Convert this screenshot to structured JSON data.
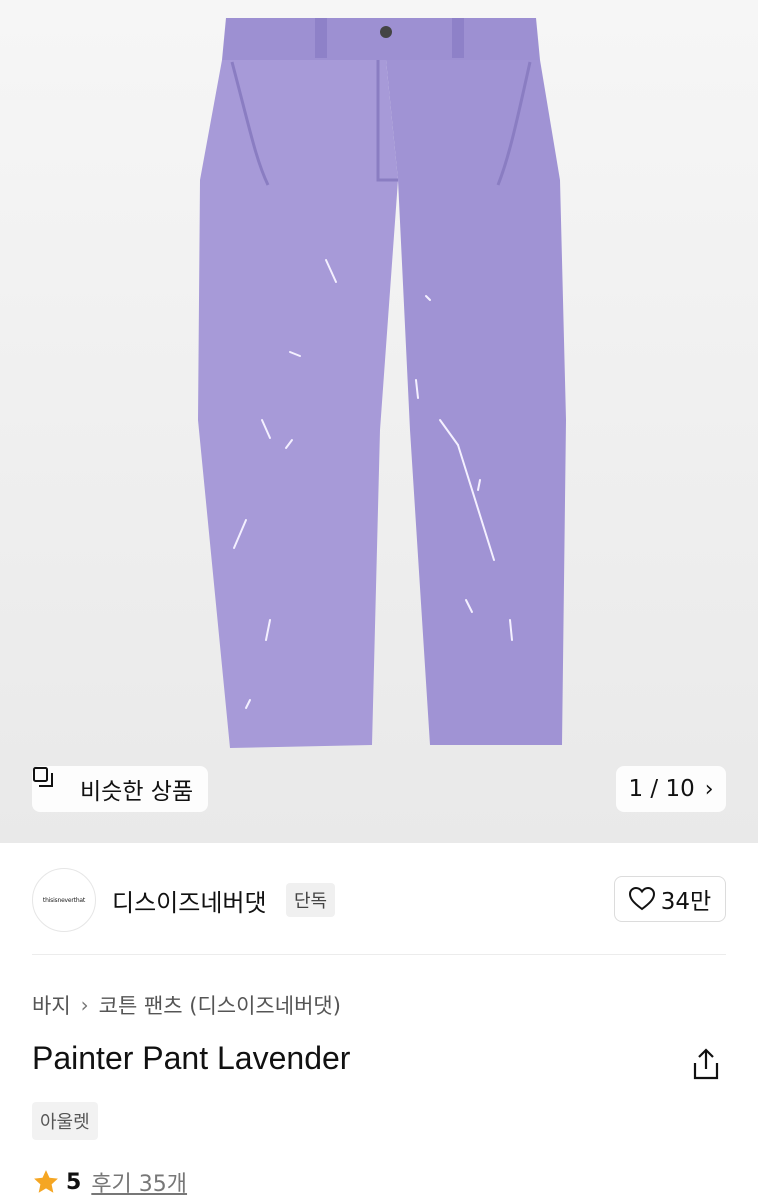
{
  "hero": {
    "similar_label": "비슷한 상품",
    "pager": "1 / 10",
    "pants_color": "#a79ad8"
  },
  "brand": {
    "logo_text": "thisisneverthat",
    "name": "디스이즈네버댓",
    "badge": "단독",
    "likes": "34만"
  },
  "breadcrumb": {
    "category": "바지",
    "subcategory": "코튼 팬츠 (디스이즈네버댓)"
  },
  "product": {
    "title": "Painter Pant Lavender",
    "tag": "아울렛"
  },
  "rating": {
    "score": "5",
    "reviews": "후기 35개"
  }
}
